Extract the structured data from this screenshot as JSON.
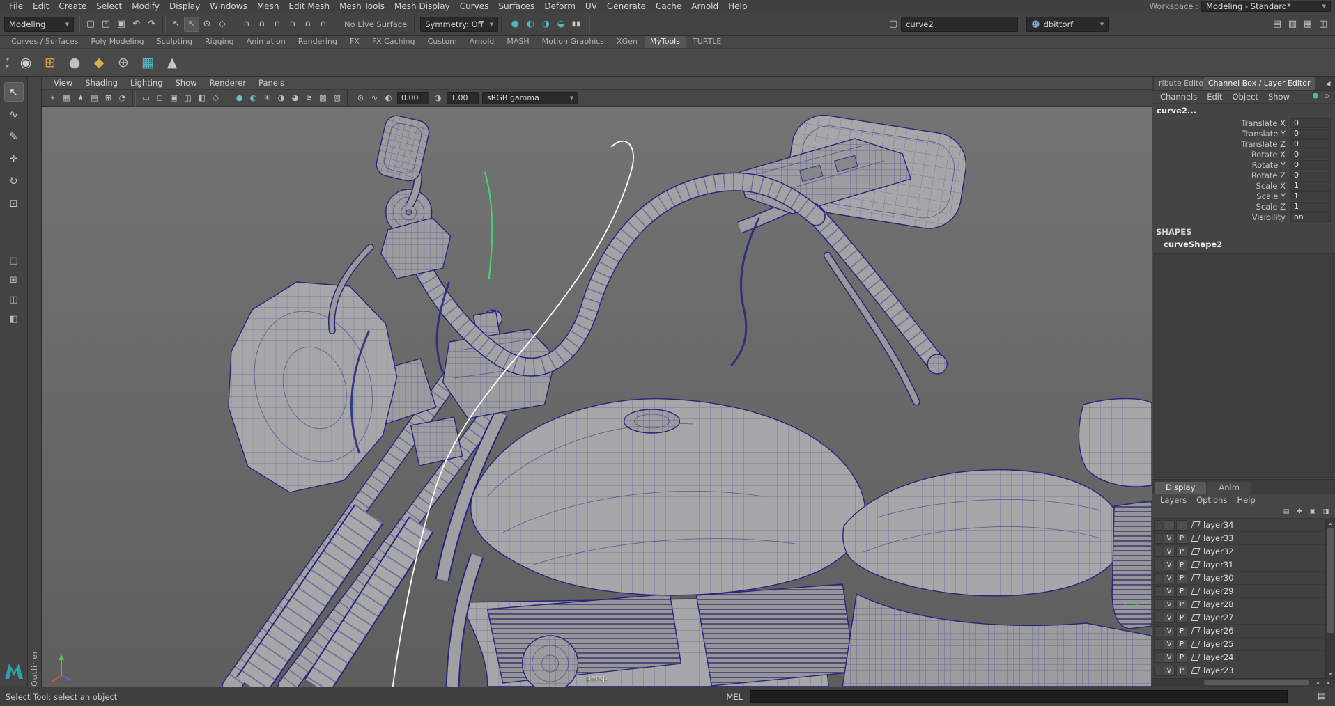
{
  "app": {
    "workspace_label": "Workspace :",
    "workspace_value": "Modeling - Standard*"
  },
  "menubar": {
    "items": [
      "File",
      "Edit",
      "Create",
      "Select",
      "Modify",
      "Display",
      "Windows",
      "Mesh",
      "Edit Mesh",
      "Mesh Tools",
      "Mesh Display",
      "Curves",
      "Surfaces",
      "Deform",
      "UV",
      "Generate",
      "Cache",
      "Arnold",
      "Help"
    ]
  },
  "statusline": {
    "menuset": "Modeling",
    "live_surface": "No Live Surface",
    "symmetry": "Symmetry: Off",
    "name_field": "curve2",
    "user_field": "dbittorf"
  },
  "shelf": {
    "tabs": [
      "Curves / Surfaces",
      "Poly Modeling",
      "Sculpting",
      "Rigging",
      "Animation",
      "Rendering",
      "FX",
      "FX Caching",
      "Custom",
      "Arnold",
      "MASH",
      "Motion Graphics",
      "XGen",
      "MyTools",
      "TURTLE"
    ],
    "item_glyphs": [
      "◉",
      "⊞",
      "●",
      "◆",
      "⊕",
      "▦",
      "▲"
    ]
  },
  "panel": {
    "menus": [
      "View",
      "Shading",
      "Lighting",
      "Show",
      "Renderer",
      "Panels"
    ],
    "exposure": "0.00",
    "gamma": "1.00",
    "colorspace": "sRGB gamma"
  },
  "viewport": {
    "camera": "persp",
    "annotation": "120",
    "outliner_label": "Outliner"
  },
  "channel_box": {
    "tab_partial": "ribute Editor",
    "tab_active": "Channel Box / Layer Editor",
    "menus": [
      "Channels",
      "Edit",
      "Object",
      "Show"
    ],
    "object_name": "curve2...",
    "attributes": [
      {
        "label": "Translate X",
        "value": "0"
      },
      {
        "label": "Translate Y",
        "value": "0"
      },
      {
        "label": "Translate Z",
        "value": "0"
      },
      {
        "label": "Rotate X",
        "value": "0"
      },
      {
        "label": "Rotate Y",
        "value": "0"
      },
      {
        "label": "Rotate Z",
        "value": "0"
      },
      {
        "label": "Scale X",
        "value": "1"
      },
      {
        "label": "Scale Y",
        "value": "1"
      },
      {
        "label": "Scale Z",
        "value": "1"
      },
      {
        "label": "Visibility",
        "value": "on"
      }
    ],
    "shapes_header": "SHAPES",
    "shape_name": "curveShape2"
  },
  "layer_editor": {
    "tabs": [
      "Display",
      "Anim"
    ],
    "menus": [
      "Layers",
      "Options",
      "Help"
    ],
    "layers": [
      {
        "v": "",
        "p": "",
        "name": "layer34"
      },
      {
        "v": "V",
        "p": "P",
        "name": "layer33"
      },
      {
        "v": "V",
        "p": "P",
        "name": "layer32"
      },
      {
        "v": "V",
        "p": "P",
        "name": "layer31"
      },
      {
        "v": "V",
        "p": "P",
        "name": "layer30"
      },
      {
        "v": "V",
        "p": "P",
        "name": "layer29"
      },
      {
        "v": "V",
        "p": "P",
        "name": "layer28"
      },
      {
        "v": "V",
        "p": "P",
        "name": "layer27"
      },
      {
        "v": "V",
        "p": "P",
        "name": "layer26"
      },
      {
        "v": "V",
        "p": "P",
        "name": "layer25"
      },
      {
        "v": "V",
        "p": "P",
        "name": "layer24"
      },
      {
        "v": "V",
        "p": "P",
        "name": "layer23"
      }
    ]
  },
  "bottom": {
    "help_text": "Select Tool: select an object",
    "command_label": "MEL"
  },
  "colors": {
    "accent_teal": "#4fb6ba",
    "wireframe": "#26267c",
    "surface": "#a6a6a8",
    "selected_curve": "#ffffff",
    "green_curve": "#45cf7a"
  },
  "icons": {
    "dropdown": "▼",
    "tiny_down": "▾",
    "tiny_right": "▸",
    "tiny_up": "▴",
    "tiny_left": "◂",
    "new_scene": "▢",
    "open_scene": "◳",
    "save_scene": "▣",
    "undo": "↶",
    "redo": "↷",
    "sel1": "↖",
    "sel2": "↖",
    "sel3": "⊙",
    "sel4": "◇",
    "magnet": "∩",
    "render1": "●",
    "render2": "◐",
    "render3": "◑",
    "render4": "◒",
    "pause": "▮▮",
    "field_box": "▢",
    "user": "☻",
    "right1": "▤",
    "right2": "▥",
    "right3": "▦",
    "right4": "◫",
    "tool_select": "↖",
    "tool_lasso": "∿",
    "tool_paint": "✎",
    "tool_move": "✛",
    "tool_rotate": "↻",
    "tool_scale": "⊡",
    "layout1": "□",
    "layout2": "⊞",
    "layout3": "◫",
    "layout4": "◧",
    "vp1": "⌖",
    "vp2": "▦",
    "vp3": "★",
    "vp4": "▤",
    "vp5": "⊞",
    "vp6": "◔",
    "vp7": "▭",
    "vp8": "◻",
    "vp9": "▣",
    "vp10": "◫",
    "vp11": "◧",
    "vp12": "◇",
    "vp13": "●",
    "vp14": "◐",
    "vp15": "☀",
    "vp16": "◑",
    "vp17": "◕",
    "vp18": "≋",
    "vp19": "▩",
    "vp20": "▨",
    "vp21": "⊙",
    "vp22": "∿",
    "expo": "◐",
    "gamma": "◑",
    "chev_left": "◀",
    "cb_icon1": "☻",
    "cb_icon2": "⊙",
    "le1": "▤",
    "le2": "✚",
    "le3": "▣",
    "le4": "◨",
    "script": "▤"
  }
}
